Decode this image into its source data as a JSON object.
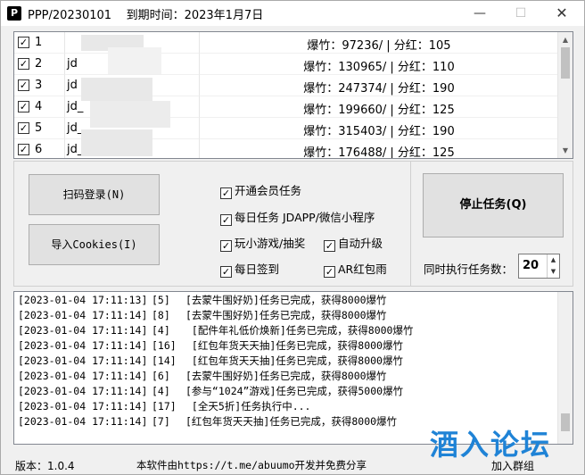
{
  "titlebar": {
    "icon_text": "P",
    "title": "PPP/20230101    到期时间：2023年1月7日",
    "minimize": "—",
    "maximize": "☐",
    "close": "✕"
  },
  "accounts": [
    {
      "no": "1",
      "name": "",
      "stats": "爆竹：97236/ | 分红：105",
      "checked": true
    },
    {
      "no": "2",
      "name": "jd",
      "stats": "爆竹：130965/ | 分红：110",
      "checked": true
    },
    {
      "no": "3",
      "name": "jd",
      "stats": "爆竹：247374/ | 分红：190",
      "checked": true
    },
    {
      "no": "4",
      "name": "jd_",
      "stats": "爆竹：199660/ | 分红：125",
      "checked": true
    },
    {
      "no": "5",
      "name": "jd_",
      "stats": "爆竹：315403/ | 分红：190",
      "checked": true
    },
    {
      "no": "6",
      "name": "jd_",
      "stats": "爆竹：176488/ | 分红：125",
      "checked": true
    }
  ],
  "buttons": {
    "scan_login": "扫码登录(N)",
    "import_cookies": "导入Cookies(I)",
    "stop_task": "停止任务(Q)"
  },
  "options": {
    "member_task": "开通会员任务",
    "daily_task": "每日任务 JDAPP/微信小程序",
    "mini_games": "玩小游戏/抽奖",
    "auto_upgrade": "自动升级",
    "daily_signin": "每日签到",
    "ar_redpacket": "AR红包雨"
  },
  "concurrency": {
    "label": "同时执行任务数：",
    "value": "20"
  },
  "log": [
    {
      "ts": "[2023-01-04 17:11:13]",
      "id": "[5]",
      "msg": "[去蒙牛围好奶]任务已完成，获得8000爆竹"
    },
    {
      "ts": "[2023-01-04 17:11:14]",
      "id": "[8]",
      "msg": "[去蒙牛围好奶]任务已完成，获得8000爆竹"
    },
    {
      "ts": "[2023-01-04 17:11:14]",
      "id": "[4]",
      "msg": " [配件年礼低价焕新]任务已完成，获得8000爆竹"
    },
    {
      "ts": "[2023-01-04 17:11:14]",
      "id": "[16]",
      "msg": " [红包年货天天抽]任务已完成，获得8000爆竹"
    },
    {
      "ts": "[2023-01-04 17:11:14]",
      "id": "[14]",
      "msg": " [红包年货天天抽]任务已完成，获得8000爆竹"
    },
    {
      "ts": "[2023-01-04 17:11:14]",
      "id": "[6]",
      "msg": "[去蒙牛围好奶]任务已完成，获得8000爆竹"
    },
    {
      "ts": "[2023-01-04 17:11:14]",
      "id": "[4]",
      "msg": "[参与“1024”游戏]任务已完成，获得5000爆竹"
    },
    {
      "ts": "[2023-01-04 17:11:14]",
      "id": "[17]",
      "msg": " [全天5折]任务执行中..."
    },
    {
      "ts": "[2023-01-04 17:11:14]",
      "id": "[7]",
      "msg": "[红包年货天天抽]任务已完成，获得8000爆竹"
    }
  ],
  "statusbar": {
    "version": "版本：1.0.4",
    "notice": "本软件由https://t.me/abuumo开发并免费分享",
    "join_group": "加入群组"
  },
  "watermark": "酒入论坛"
}
